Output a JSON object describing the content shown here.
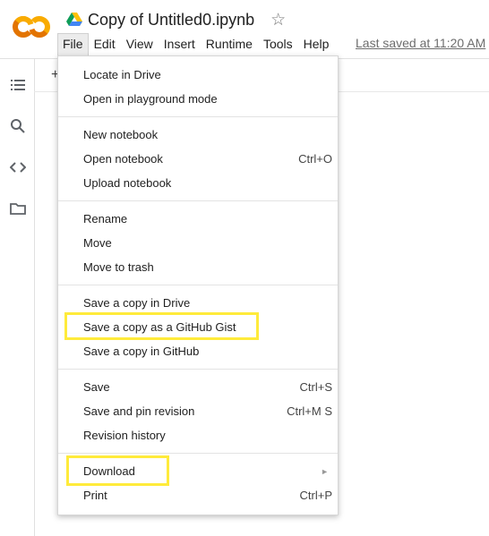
{
  "header": {
    "title": "Copy of Untitled0.ipynb",
    "last_saved": "Last saved at 11:20 AM"
  },
  "menubar": {
    "items": [
      "File",
      "Edit",
      "View",
      "Insert",
      "Runtime",
      "Tools",
      "Help"
    ],
    "active": "File"
  },
  "file_menu": {
    "groups": [
      [
        {
          "label": "Locate in Drive",
          "shortcut": ""
        },
        {
          "label": "Open in playground mode",
          "shortcut": ""
        }
      ],
      [
        {
          "label": "New notebook",
          "shortcut": ""
        },
        {
          "label": "Open notebook",
          "shortcut": "Ctrl+O"
        },
        {
          "label": "Upload notebook",
          "shortcut": ""
        }
      ],
      [
        {
          "label": "Rename",
          "shortcut": ""
        },
        {
          "label": "Move",
          "shortcut": ""
        },
        {
          "label": "Move to trash",
          "shortcut": ""
        }
      ],
      [
        {
          "label": "Save a copy in Drive",
          "shortcut": ""
        },
        {
          "label": "Save a copy as a GitHub Gist",
          "shortcut": ""
        },
        {
          "label": "Save a copy in GitHub",
          "shortcut": ""
        }
      ],
      [
        {
          "label": "Save",
          "shortcut": "Ctrl+S"
        },
        {
          "label": "Save and pin revision",
          "shortcut": "Ctrl+M S"
        },
        {
          "label": "Revision history",
          "shortcut": ""
        }
      ],
      [
        {
          "label": "Download",
          "shortcut": ""
        },
        {
          "label": "Print",
          "shortcut": "Ctrl+P"
        }
      ]
    ]
  },
  "sidebar": {
    "icons": [
      "table-of-contents-icon",
      "search-icon",
      "code-snippets-icon",
      "files-folder-icon"
    ]
  },
  "toolbar": {
    "add_symbol": "+"
  },
  "colors": {
    "logo_orange": "#f9ab00",
    "logo_dark_orange": "#e37400",
    "highlight": "#ffeb3b"
  }
}
